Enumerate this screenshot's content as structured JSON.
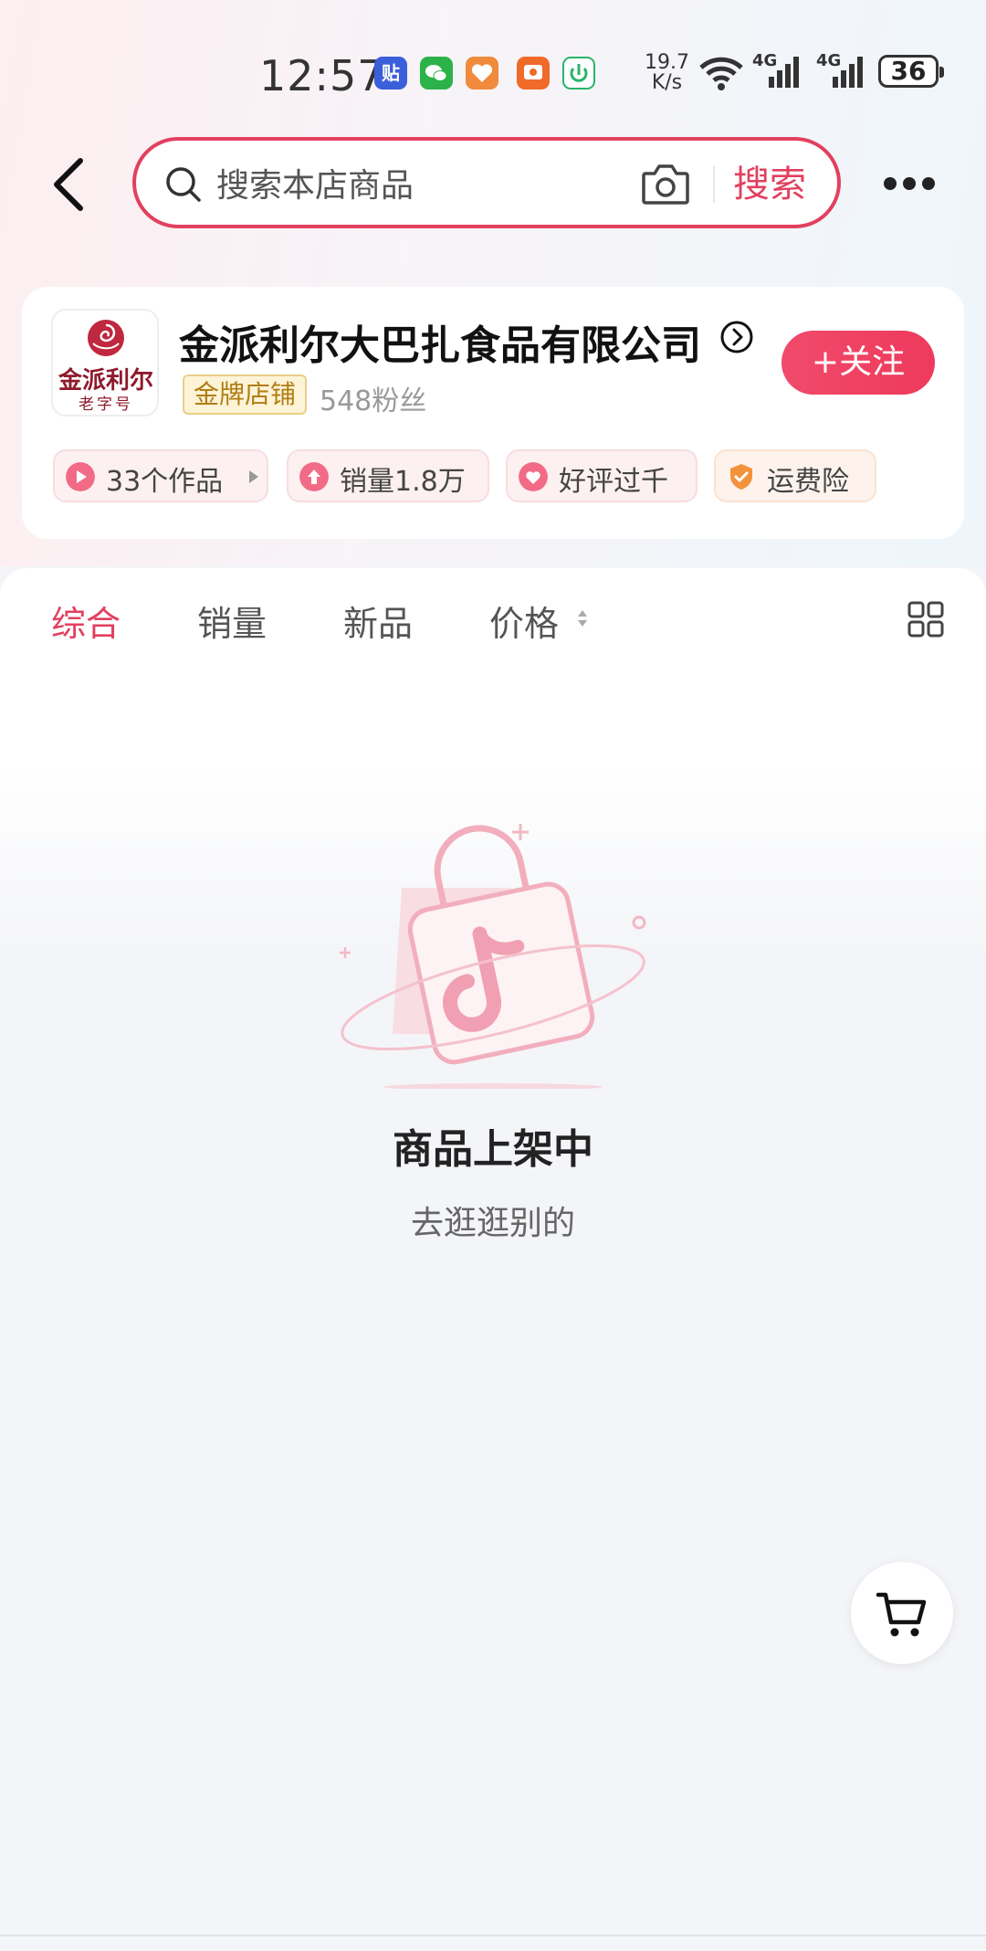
{
  "status_bar": {
    "time": "12:57",
    "app_icons": [
      "tieba-icon",
      "wechat-icon",
      "health-app-icon",
      "video-app-icon",
      "power-app-icon"
    ],
    "net_speed_value": "19.7",
    "net_speed_unit": "K/s",
    "signal_label_1": "4G",
    "signal_label_2": "4G",
    "battery": "36"
  },
  "search": {
    "placeholder": "搜索本店商品",
    "button_label": "搜索"
  },
  "shop": {
    "logo_text": "金派利尔",
    "logo_subtext": "老字号",
    "name": "金派利尔大巴扎食品有限公司",
    "badge": "金牌店铺",
    "fans": "548粉丝",
    "follow_label": "+关注",
    "tags": [
      {
        "label": "33个作品",
        "icon": "play-icon"
      },
      {
        "label": "销量1.8万",
        "icon": "sales-up-icon"
      },
      {
        "label": "好评过千",
        "icon": "heart-icon"
      },
      {
        "label": "运费险",
        "icon": "shield-icon"
      }
    ]
  },
  "sort_tabs": [
    {
      "label": "综合",
      "active": true
    },
    {
      "label": "销量",
      "active": false
    },
    {
      "label": "新品",
      "active": false
    },
    {
      "label": "价格",
      "active": false
    }
  ],
  "empty_state": {
    "title": "商品上架中",
    "subtitle": "去逛逛别的"
  },
  "colors": {
    "accent": "#e2405f",
    "gold_badge_text": "#b07d12",
    "tag_bg": "#fdf0f1"
  }
}
